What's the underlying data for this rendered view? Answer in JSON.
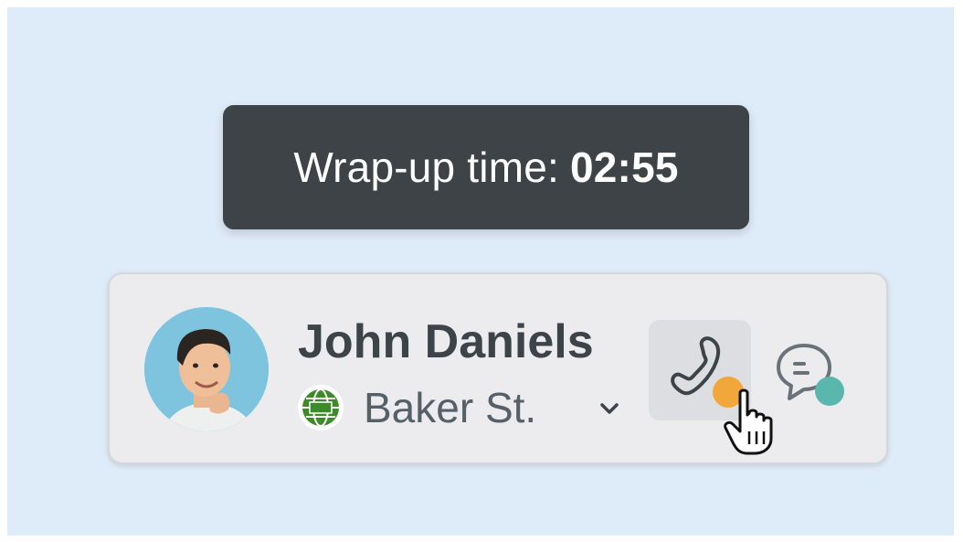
{
  "tooltip": {
    "label": "Wrap-up time:",
    "time": "02:55"
  },
  "agent": {
    "name": "John Daniels",
    "location": "Baker St.",
    "avatar_icon": "person-avatar",
    "location_icon": "globe-icon"
  },
  "channels": {
    "call": {
      "icon": "phone-icon",
      "status_color": "#f2a73b"
    },
    "chat": {
      "icon": "chat-bubble-icon",
      "status_color": "#5ab7ad"
    }
  },
  "colors": {
    "background": "#deebf8",
    "tooltip_bg": "#3d4347",
    "card_bg": "#ececee"
  }
}
